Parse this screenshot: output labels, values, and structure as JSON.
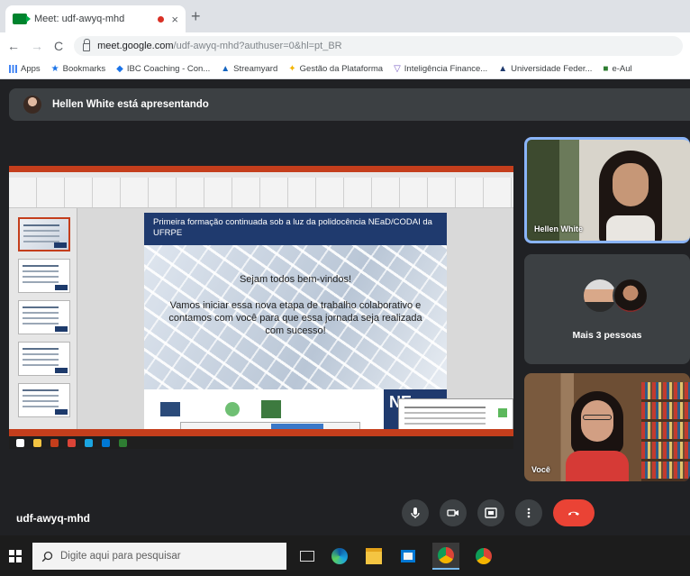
{
  "browser": {
    "tab_title": "Meet: udf-awyq-mhd",
    "tab_close": "×",
    "new_tab": "+",
    "back": "←",
    "forward": "→",
    "reload": "C",
    "url_host": "meet.google.com",
    "url_path": "/udf-awyq-mhd?authuser=0&hl=pt_BR",
    "bookmarks": [
      {
        "label": "Apps"
      },
      {
        "label": "Bookmarks"
      },
      {
        "label": "IBC Coaching - Con..."
      },
      {
        "label": "Streamyard"
      },
      {
        "label": "Gestão da Plataforma"
      },
      {
        "label": "Inteligência Finance..."
      },
      {
        "label": "Universidade Feder..."
      },
      {
        "label": "e-Aul"
      }
    ]
  },
  "meet": {
    "presenter_text": "Hellen White está apresentando",
    "meeting_code": "udf-awyq-mhd",
    "more_people": "Mais 3 pessoas",
    "tile_1_name": "Hellen White",
    "tile_3_name": "Você",
    "accent": "#8ab4f8",
    "end_call_color": "#ea4335"
  },
  "slide": {
    "header": "Primeira formação continuada sob a luz da polidocência NEaD/CODAI da UFRPE",
    "welcome": "Sejam todos bem-vindos!",
    "body": "Vamos iniciar essa nova etapa de trabalho colaborativo e contamos com você para que essa jornada seja realizada com sucesso!",
    "footer_logo": "NE"
  },
  "taskbar": {
    "search_placeholder": "Digite aqui para pesquisar"
  }
}
